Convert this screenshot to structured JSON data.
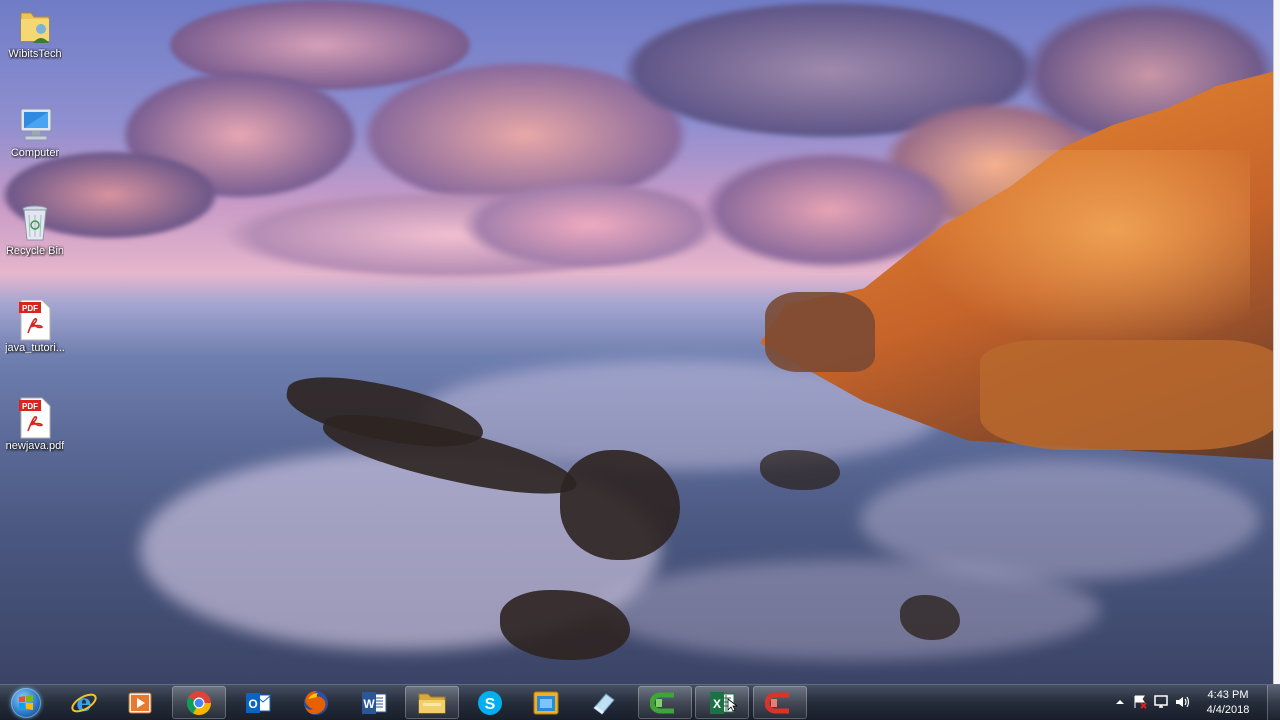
{
  "desktop": {
    "icons": [
      {
        "label": "WibitsTech",
        "icon": "user-folder-icon"
      },
      {
        "label": "Computer",
        "icon": "computer-icon"
      },
      {
        "label": "Recycle Bin",
        "icon": "recycle-bin-icon"
      },
      {
        "label": "java_tutori...",
        "icon": "pdf-file-icon",
        "badge": "PDF"
      },
      {
        "label": "newjava.pdf",
        "icon": "pdf-file-icon",
        "badge": "PDF"
      }
    ]
  },
  "taskbar": {
    "start_icon": "windows-start-icon",
    "apps": [
      {
        "icon": "internet-explorer-icon",
        "glyph": "e",
        "color": "#3aa0e8",
        "open": false
      },
      {
        "icon": "media-player-icon",
        "glyph": "▶",
        "color": "#e0752b",
        "open": false
      },
      {
        "icon": "chrome-icon",
        "glyph": "",
        "color": "#4285f4",
        "open": true
      },
      {
        "icon": "outlook-icon",
        "glyph": "O",
        "color": "#0a64c2",
        "open": false
      },
      {
        "icon": "firefox-icon",
        "glyph": "",
        "color": "#e66000",
        "open": false
      },
      {
        "icon": "word-icon",
        "glyph": "W",
        "color": "#2b5797",
        "open": false
      },
      {
        "icon": "file-explorer-icon",
        "glyph": "",
        "color": "#e8c25a",
        "open": true
      },
      {
        "icon": "skype-icon",
        "glyph": "S",
        "color": "#00aff0",
        "open": false
      },
      {
        "icon": "app-window-icon",
        "glyph": "",
        "color": "#f0b020",
        "open": false
      },
      {
        "icon": "eraser-icon",
        "glyph": "",
        "color": "#9ac8e0",
        "open": false
      },
      {
        "icon": "camtasia-green-icon",
        "glyph": "C",
        "color": "#3fa535",
        "open": true
      },
      {
        "icon": "excel-icon",
        "glyph": "X",
        "color": "#1e7145",
        "open": true
      },
      {
        "icon": "camtasia-red-icon",
        "glyph": "C",
        "color": "#d9342b",
        "open": true
      }
    ],
    "tray": {
      "icons": [
        "show-hidden-icons-icon",
        "action-center-icon",
        "network-icon",
        "volume-icon"
      ],
      "time": "4:43 PM",
      "date": "4/4/2018"
    }
  }
}
